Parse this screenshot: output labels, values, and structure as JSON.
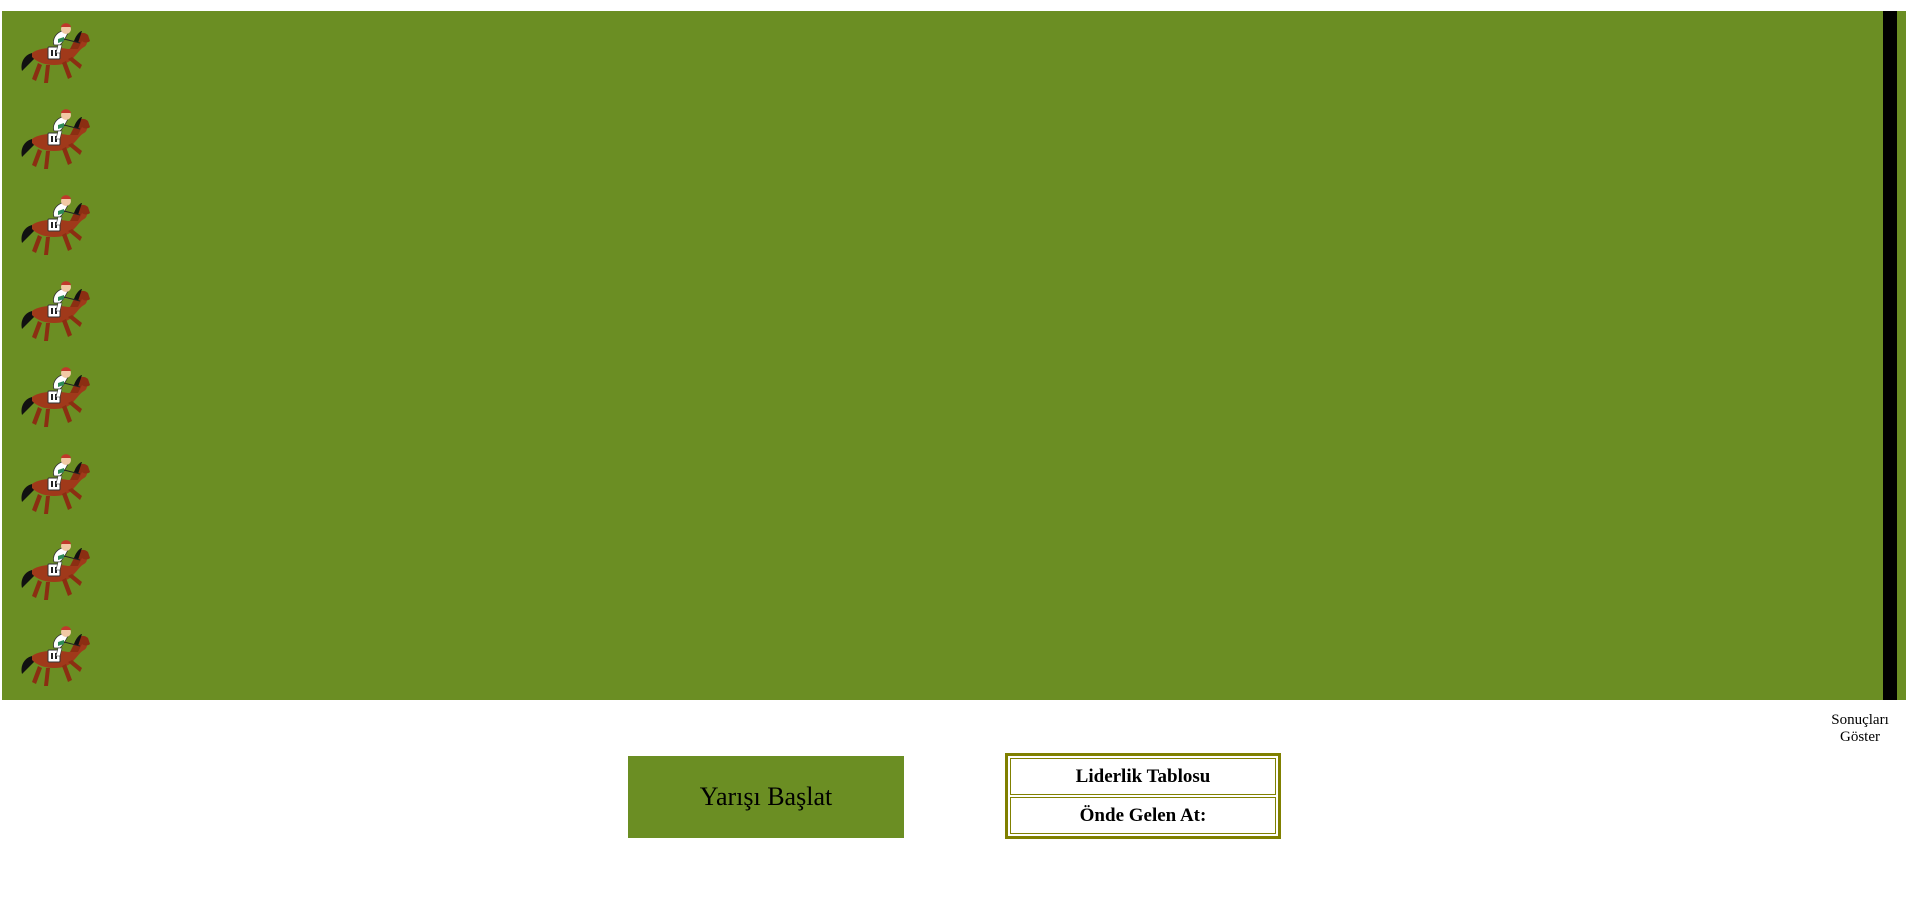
{
  "track": {
    "color": "#6b8e23",
    "finish_line_color": "#000000",
    "lanes": [
      {
        "horse_icon": "horse-with-jockey-icon"
      },
      {
        "horse_icon": "horse-with-jockey-icon"
      },
      {
        "horse_icon": "horse-with-jockey-icon"
      },
      {
        "horse_icon": "horse-with-jockey-icon"
      },
      {
        "horse_icon": "horse-with-jockey-icon"
      },
      {
        "horse_icon": "horse-with-jockey-icon"
      },
      {
        "horse_icon": "horse-with-jockey-icon"
      },
      {
        "horse_icon": "horse-with-jockey-icon"
      }
    ]
  },
  "controls": {
    "show_results_label": "Sonuçları Göster",
    "start_race_label": "Yarışı Başlat"
  },
  "leaderboard": {
    "title": "Liderlik Tablosu",
    "leader_label": "Önde Gelen At:"
  }
}
